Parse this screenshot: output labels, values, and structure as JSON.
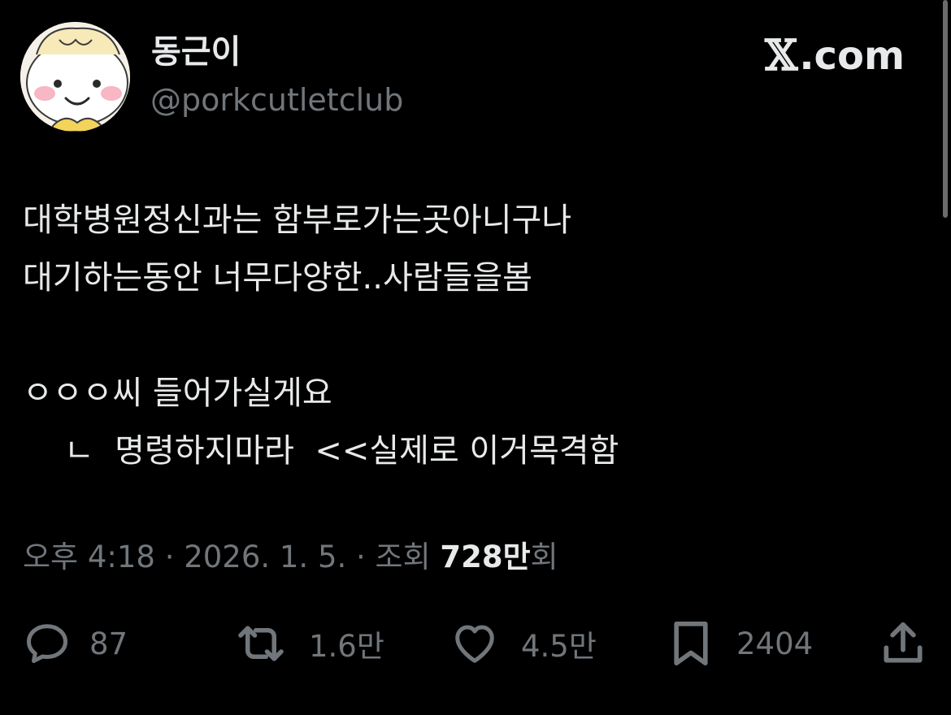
{
  "author": {
    "display_name": "동근이",
    "handle": "@porkcutletclub",
    "avatar_icon": "cartoon-dumpling-face-avatar"
  },
  "brand": {
    "x_mark": "𝕏",
    "domain": ".com"
  },
  "tweet": {
    "lines": [
      "대학병원정신과는 함부로가는곳아니구나",
      "대기하는동안 너무다양한..사람들을봄",
      "",
      "ㅇㅇㅇ씨 들어가실게요",
      "    ㄴ  명령하지마라  <<실제로 이거목격함"
    ]
  },
  "meta": {
    "prefix": "오후 4:18 · 2026. 1. 5. · 조회 ",
    "views": "728만",
    "suffix": "회"
  },
  "actions": {
    "reply": {
      "icon": "reply-bubble-icon",
      "count": "87"
    },
    "retweet": {
      "icon": "retweet-icon",
      "count": "1.6만"
    },
    "like": {
      "icon": "heart-icon",
      "count": "4.5만"
    },
    "bookmark": {
      "icon": "bookmark-icon",
      "count": "2404"
    },
    "share": {
      "icon": "share-icon"
    }
  },
  "colors": {
    "background": "#000000",
    "primary_text": "#e7e9ea",
    "secondary_text": "#71767b"
  }
}
